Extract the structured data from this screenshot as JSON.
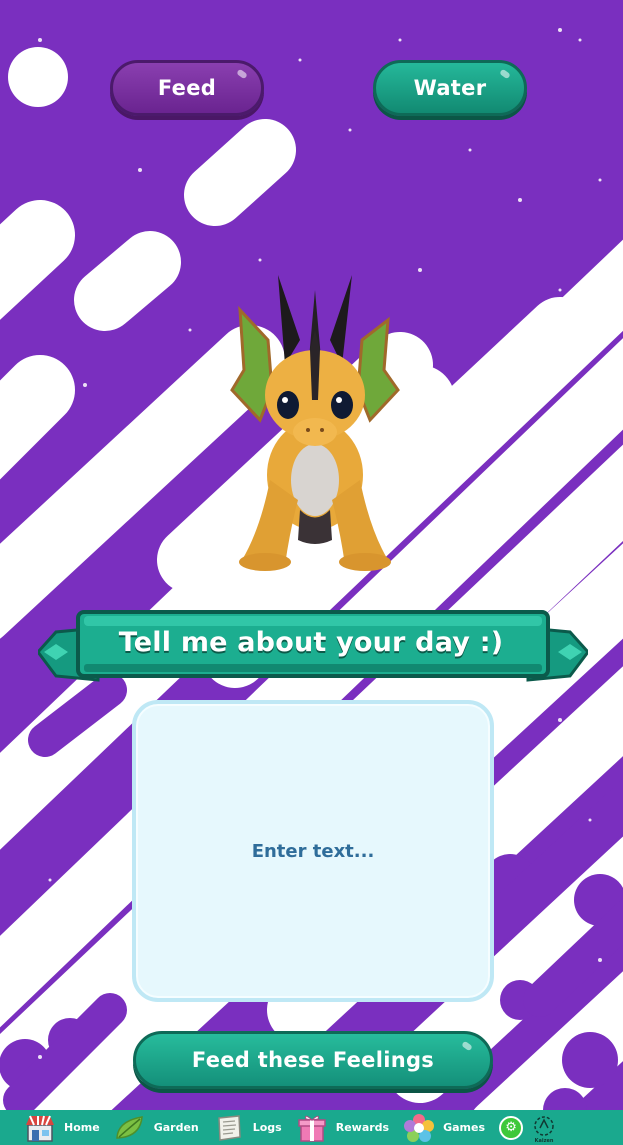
{
  "top_buttons": {
    "feed_label": "Feed",
    "water_label": "Water"
  },
  "prompt": {
    "banner_text": "Tell me about your day :)"
  },
  "journal": {
    "placeholder": "Enter text...",
    "value": ""
  },
  "submit": {
    "label": "Feed these Feelings"
  },
  "bottom_nav": {
    "items": [
      {
        "label": "Home",
        "icon": "shop-icon"
      },
      {
        "label": "Garden",
        "icon": "leaf-icon"
      },
      {
        "label": "Logs",
        "icon": "scroll-icon"
      },
      {
        "label": "Rewards",
        "icon": "gift-icon"
      },
      {
        "label": "Games",
        "icon": "flower-icon"
      }
    ],
    "settings_icon": "gear-icon",
    "logo_text": "Kaizen"
  },
  "colors": {
    "background_purple": "#7a2fbf",
    "stripe_white": "#ffffff",
    "feed_button": "#7a3aa0",
    "teal_accent": "#1aa98e",
    "text_box_bg": "#e6f8fd",
    "placeholder_text": "#2f6d9a"
  }
}
